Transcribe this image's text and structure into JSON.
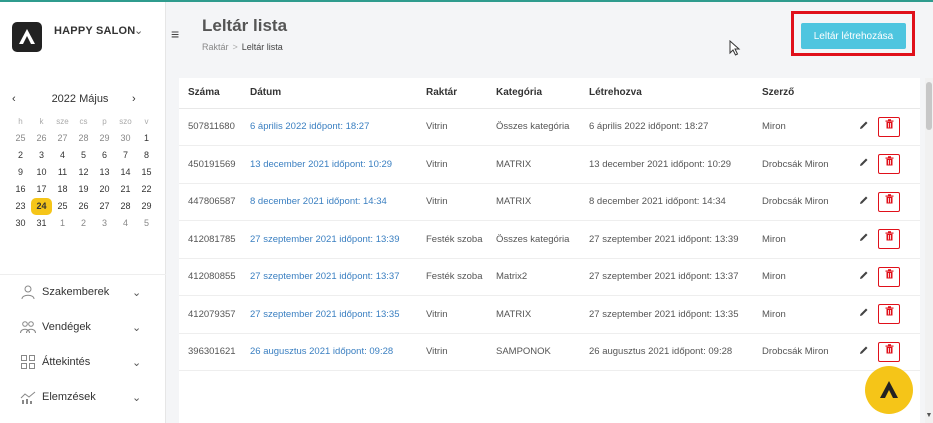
{
  "brand": {
    "name": "HAPPY SALON",
    "chevron": "⌄"
  },
  "calendar": {
    "prev": "‹",
    "next": "›",
    "title": "2022 Május",
    "weekdays": [
      "h",
      "k",
      "sze",
      "cs",
      "p",
      "szo",
      "v"
    ],
    "weeks": [
      [
        {
          "d": "25",
          "m": 1
        },
        {
          "d": "26",
          "m": 1
        },
        {
          "d": "27",
          "m": 1
        },
        {
          "d": "28",
          "m": 1
        },
        {
          "d": "29",
          "m": 1
        },
        {
          "d": "30",
          "m": 1
        },
        {
          "d": "1"
        }
      ],
      [
        {
          "d": "2"
        },
        {
          "d": "3"
        },
        {
          "d": "4"
        },
        {
          "d": "5"
        },
        {
          "d": "6"
        },
        {
          "d": "7"
        },
        {
          "d": "8"
        }
      ],
      [
        {
          "d": "9"
        },
        {
          "d": "10"
        },
        {
          "d": "11"
        },
        {
          "d": "12"
        },
        {
          "d": "13"
        },
        {
          "d": "14"
        },
        {
          "d": "15"
        }
      ],
      [
        {
          "d": "16"
        },
        {
          "d": "17"
        },
        {
          "d": "18"
        },
        {
          "d": "19"
        },
        {
          "d": "20"
        },
        {
          "d": "21"
        },
        {
          "d": "22"
        }
      ],
      [
        {
          "d": "23"
        },
        {
          "d": "24",
          "t": 1
        },
        {
          "d": "25"
        },
        {
          "d": "26"
        },
        {
          "d": "27"
        },
        {
          "d": "28"
        },
        {
          "d": "29"
        }
      ],
      [
        {
          "d": "30"
        },
        {
          "d": "31"
        },
        {
          "d": "1",
          "m": 1
        },
        {
          "d": "2",
          "m": 1
        },
        {
          "d": "3",
          "m": 1
        },
        {
          "d": "4",
          "m": 1
        },
        {
          "d": "5",
          "m": 1
        }
      ]
    ],
    "today_color": "#f5c518"
  },
  "nav": [
    {
      "label": "Szakemberek",
      "icon": "person-icon"
    },
    {
      "label": "Vendégek",
      "icon": "people-icon"
    },
    {
      "label": "Áttekintés",
      "icon": "grid-icon"
    },
    {
      "label": "Elemzések",
      "icon": "chart-icon"
    }
  ],
  "header": {
    "menu_icon": "≡",
    "title": "Leltár lista",
    "breadcrumb": {
      "root": "Raktár",
      "sep": ">",
      "current": "Leltár lista"
    },
    "create_button": "Leltár létrehozása"
  },
  "table": {
    "columns": [
      "Száma",
      "Dátum",
      "Raktár",
      "Kategória",
      "Létrehozva",
      "Szerző"
    ],
    "rows": [
      [
        "507811680",
        "6 április 2022 időpont: 18:27",
        "Vitrin",
        "Összes kategória",
        "6 április 2022 időpont: 18:27",
        "Miron"
      ],
      [
        "450191569",
        "13 december 2021 időpont: 10:29",
        "Vitrin",
        "MATRIX",
        "13 december 2021 időpont: 10:29",
        "Drobcsák Miron"
      ],
      [
        "447806587",
        "8 december 2021 időpont: 14:34",
        "Vitrin",
        "MATRIX",
        "8 december 2021 időpont: 14:34",
        "Drobcsák Miron"
      ],
      [
        "412081785",
        "27 szeptember 2021 időpont: 13:39",
        "Festék szoba",
        "Összes kategória",
        "27 szeptember 2021 időpont: 13:39",
        "Miron"
      ],
      [
        "412080855",
        "27 szeptember 2021 időpont: 13:37",
        "Festék szoba",
        "Matrix2",
        "27 szeptember 2021 időpont: 13:37",
        "Miron"
      ],
      [
        "412079357",
        "27 szeptember 2021 időpont: 13:35",
        "Vitrin",
        "MATRIX",
        "27 szeptember 2021 időpont: 13:35",
        "Miron"
      ],
      [
        "396301621",
        "26 augusztus 2021 időpont: 09:28",
        "Vitrin",
        "SAMPONOK",
        "26 augusztus 2021 időpont: 09:28",
        "Drobcsák Miron"
      ]
    ],
    "edit_icon": "pencil-icon",
    "delete_icon": "trash-icon"
  },
  "colors": {
    "accent": "#4ec5df",
    "highlight": "#e0101a",
    "link": "#3a7fc1",
    "fab": "#f5c518",
    "topline": "#2f9c8e"
  }
}
